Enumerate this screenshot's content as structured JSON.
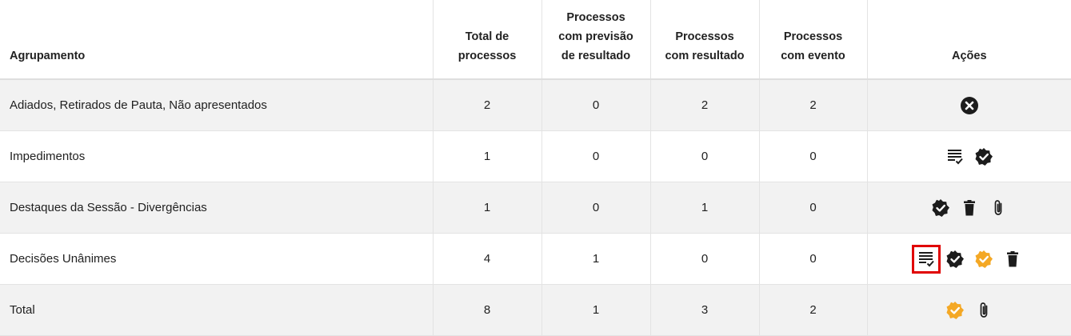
{
  "headers": {
    "agrupamento": "Agrupamento",
    "total_l1": "Total de",
    "total_l2": "processos",
    "previsao_l1": "Processos",
    "previsao_l2": "com previsão",
    "previsao_l3": "de resultado",
    "resultado_l1": "Processos",
    "resultado_l2": "com resultado",
    "evento_l1": "Processos",
    "evento_l2": "com evento",
    "acoes": "Ações"
  },
  "rows": [
    {
      "name": "Adiados, Retirados de Pauta, Não apresentados",
      "total": "2",
      "previsao": "0",
      "resultado": "2",
      "evento": "2"
    },
    {
      "name": "Impedimentos",
      "total": "1",
      "previsao": "0",
      "resultado": "0",
      "evento": "0"
    },
    {
      "name": "Destaques da Sessão - Divergências",
      "total": "1",
      "previsao": "0",
      "resultado": "1",
      "evento": "0"
    },
    {
      "name": "Decisões Unânimes",
      "total": "4",
      "previsao": "1",
      "resultado": "0",
      "evento": "0"
    },
    {
      "name": "Total",
      "total": "8",
      "previsao": "1",
      "resultado": "3",
      "evento": "2"
    }
  ],
  "colors": {
    "icon_dark": "#1c1c1c",
    "icon_orange": "#f4a825",
    "highlight_border": "#e00000"
  }
}
